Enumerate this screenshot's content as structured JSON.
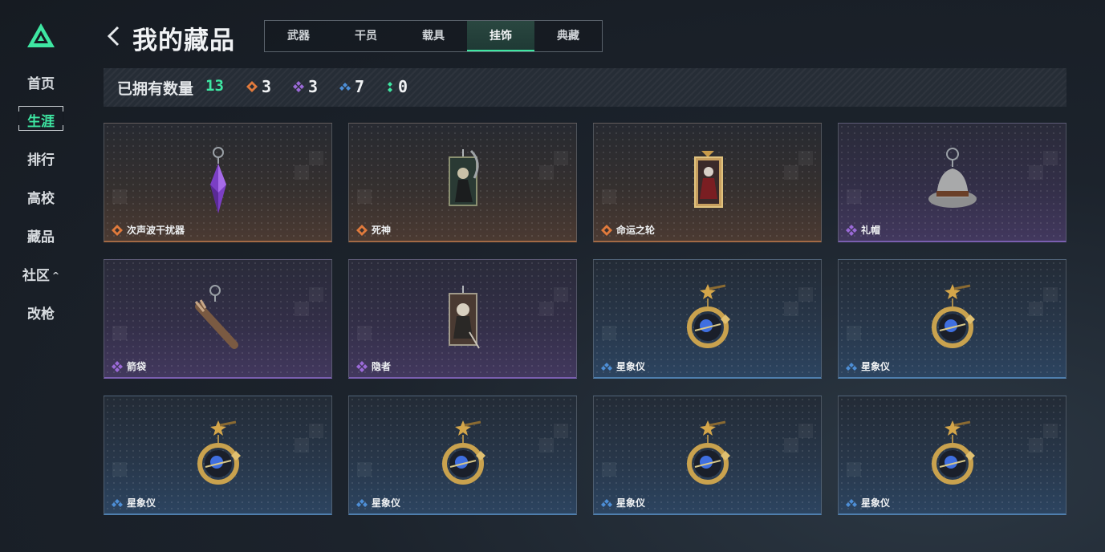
{
  "sidebar": {
    "logo": "triangle-logo-icon",
    "items": [
      {
        "label": "首页"
      },
      {
        "label": "生涯"
      },
      {
        "label": "排行"
      },
      {
        "label": "高校"
      },
      {
        "label": "藏品"
      },
      {
        "label": "社区",
        "caret": "^"
      },
      {
        "label": "改枪"
      }
    ],
    "active_index": 1
  },
  "header": {
    "back_icon": "chevron-left-icon",
    "title": "我的藏品",
    "tabs": [
      {
        "label": "武器"
      },
      {
        "label": "干员"
      },
      {
        "label": "载具"
      },
      {
        "label": "挂饰"
      },
      {
        "label": "典藏"
      }
    ],
    "active_tab": 3
  },
  "stats": {
    "label": "已拥有数量",
    "total": "13",
    "groups": [
      {
        "icon": "orange-rarity-icon",
        "color": "#e07a3c",
        "value": "3"
      },
      {
        "icon": "purple-rarity-icon",
        "color": "#9b6ad8",
        "value": "3"
      },
      {
        "icon": "blue-rarity-icon",
        "color": "#4d8ed6",
        "value": "7"
      },
      {
        "icon": "green-rarity-icon",
        "color": "#3ee6a2",
        "value": "0"
      }
    ]
  },
  "items": [
    {
      "name": "次声波干扰器",
      "rarity": "orange",
      "icon": "crystal-pendant-icon"
    },
    {
      "name": "死神",
      "rarity": "orange",
      "icon": "reaper-card-icon"
    },
    {
      "name": "命运之轮",
      "rarity": "orange",
      "icon": "fortune-wheel-card-icon"
    },
    {
      "name": "礼帽",
      "rarity": "purple",
      "icon": "fedora-hat-icon"
    },
    {
      "name": "箭袋",
      "rarity": "purple",
      "icon": "quiver-icon"
    },
    {
      "name": "隐者",
      "rarity": "purple",
      "icon": "hermit-card-icon"
    },
    {
      "name": "星象仪",
      "rarity": "blue",
      "icon": "astrolabe-icon"
    },
    {
      "name": "星象仪",
      "rarity": "blue",
      "icon": "astrolabe-icon"
    },
    {
      "name": "星象仪",
      "rarity": "blue",
      "icon": "astrolabe-icon"
    },
    {
      "name": "星象仪",
      "rarity": "blue",
      "icon": "astrolabe-icon"
    },
    {
      "name": "星象仪",
      "rarity": "blue",
      "icon": "astrolabe-icon"
    },
    {
      "name": "星象仪",
      "rarity": "blue",
      "icon": "astrolabe-icon"
    }
  ]
}
